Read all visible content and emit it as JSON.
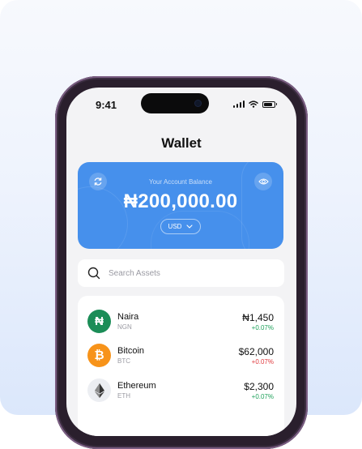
{
  "status_bar": {
    "time": "9:41"
  },
  "header": {
    "title": "Wallet"
  },
  "balance": {
    "label": "Your Account Balance",
    "amount": "₦200,000.00",
    "currency": "USD"
  },
  "search": {
    "placeholder": "Search Assets"
  },
  "assets": [
    {
      "name": "Naira",
      "code": "NGN",
      "price": "₦1,450",
      "change": "+0.07%",
      "change_color": "#1fa15b",
      "icon": "naira-icon",
      "icon_bg": "#1b8d57",
      "glyph": "₦"
    },
    {
      "name": "Bitcoin",
      "code": "BTC",
      "price": "$62,000",
      "change": "+0.07%",
      "change_color": "#e0393d",
      "icon": "bitcoin-icon",
      "icon_bg": "#f7931a",
      "glyph": "₿"
    },
    {
      "name": "Ethereum",
      "code": "ETH",
      "price": "$2,300",
      "change": "+0.07%",
      "change_color": "#1fa15b",
      "icon": "ethereum-icon",
      "icon_bg": "#eceef2",
      "glyph": ""
    }
  ],
  "colors": {
    "card": "#4690ec",
    "background": "#f3f3f5",
    "positive": "#1fa15b",
    "negative": "#e0393d"
  }
}
